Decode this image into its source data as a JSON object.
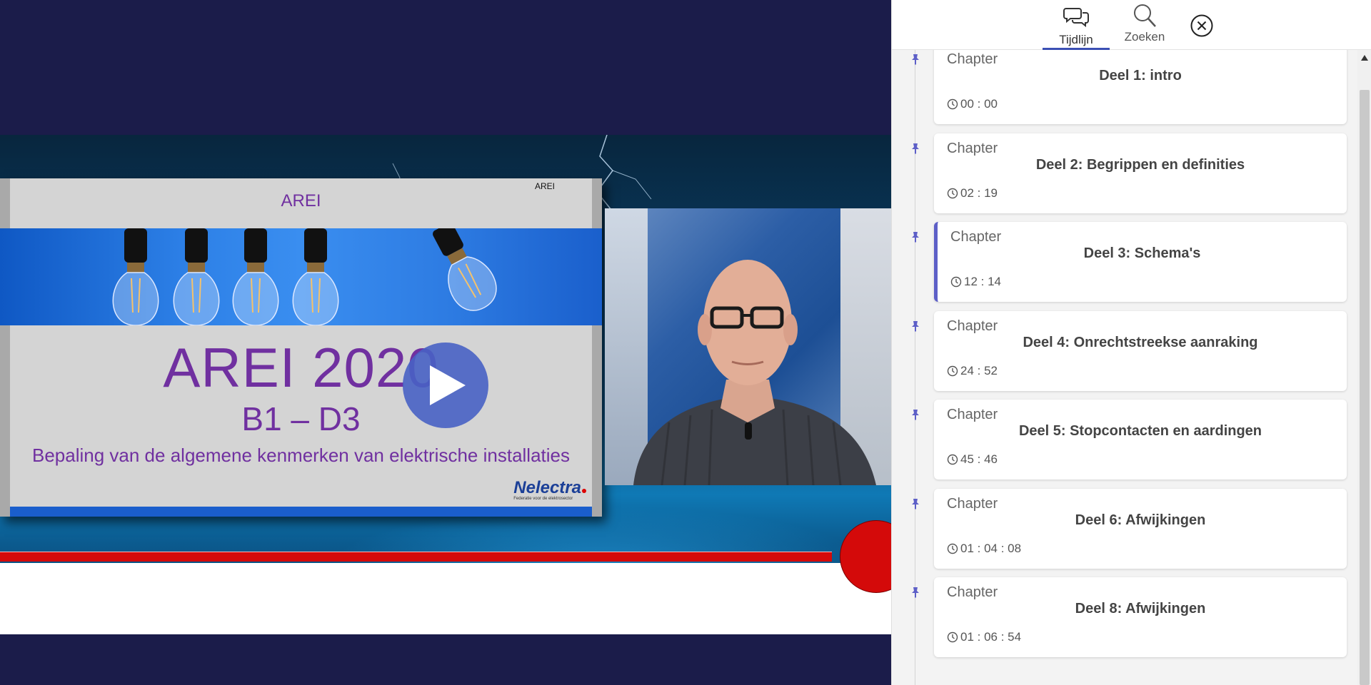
{
  "slide": {
    "top_title": "AREI",
    "corner_tag": "AREI",
    "main_title": "AREI 2020",
    "subtitle": "B1 – D3",
    "description": "Bepaling van de algemene kenmerken van elektrische installaties",
    "logo_name": "Nelectra",
    "logo_tagline": "Federatie voor de elektrosector"
  },
  "panel": {
    "tabs": [
      {
        "label": "Tijdlijn",
        "icon": "chat-bubbles-icon",
        "active": true
      },
      {
        "label": "Zoeken",
        "icon": "search-icon",
        "active": false
      }
    ],
    "close_icon": "close-circle-icon"
  },
  "chapters": [
    {
      "kind": "Chapter",
      "title": "Deel 1: intro",
      "time": "00 : 00",
      "active": false
    },
    {
      "kind": "Chapter",
      "title": "Deel 2: Begrippen en definities",
      "time": "02 : 19",
      "active": false
    },
    {
      "kind": "Chapter",
      "title": "Deel 3: Schema's",
      "time": "12 : 14",
      "active": true
    },
    {
      "kind": "Chapter",
      "title": "Deel 4: Onrechtstreekse aanraking",
      "time": "24 : 52",
      "active": false
    },
    {
      "kind": "Chapter",
      "title": "Deel 5: Stopcontacten en aardingen",
      "time": "45 : 46",
      "active": false
    },
    {
      "kind": "Chapter",
      "title": "Deel 6: Afwijkingen",
      "time": "01 : 04 : 08",
      "active": false
    },
    {
      "kind": "Chapter",
      "title": "Deel 8: Afwijkingen",
      "time": "01 : 06 : 54",
      "active": false
    }
  ],
  "colors": {
    "background": "#1b1c4a",
    "accent": "#3b4fb4",
    "slide_text": "#7030a0",
    "red_bar": "#d40a0a",
    "play_button": "#4862c4"
  }
}
